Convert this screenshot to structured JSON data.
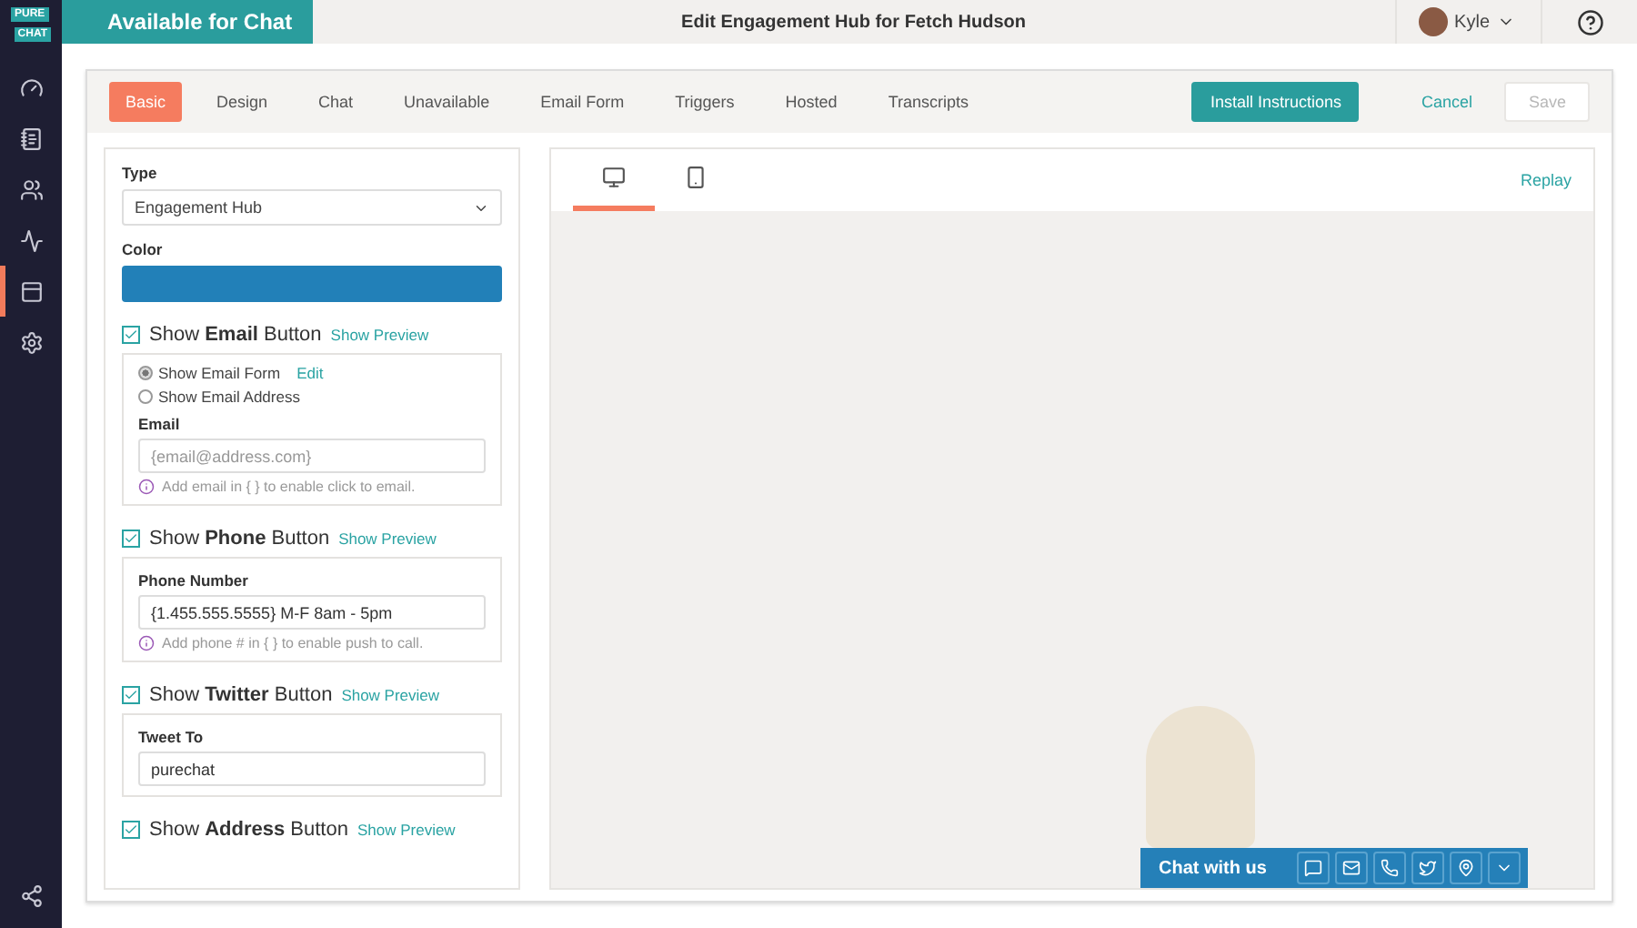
{
  "logo": {
    "line_1": "PURE",
    "line_2": "CHAT"
  },
  "sidebar": {
    "items": [
      {
        "kind": "gauge",
        "selected": false
      },
      {
        "kind": "notes",
        "selected": false
      },
      {
        "kind": "people",
        "selected": false
      },
      {
        "kind": "analytics",
        "selected": false
      },
      {
        "kind": "widget",
        "selected": true
      },
      {
        "kind": "settings",
        "selected": false
      }
    ],
    "bottom": {
      "kind": "share"
    }
  },
  "status": "Available for Chat",
  "page_title": "Edit Engagement Hub for Fetch Hudson",
  "user": {
    "name": "Kyle"
  },
  "tabs": [
    {
      "label": "Basic",
      "selected": true
    },
    {
      "label": "Design",
      "selected": false
    },
    {
      "label": "Chat",
      "selected": false
    },
    {
      "label": "Unavailable",
      "selected": false
    },
    {
      "label": "Email Form",
      "selected": false
    },
    {
      "label": "Triggers",
      "selected": false
    },
    {
      "label": "Hosted",
      "selected": false
    },
    {
      "label": "Transcripts",
      "selected": false
    }
  ],
  "actions": {
    "install": "Install Instructions",
    "cancel": "Cancel",
    "save": {
      "label": "Save",
      "disabled": true
    }
  },
  "type_field": {
    "label": "Type",
    "value": "Engagement Hub"
  },
  "color_field": {
    "label": "Color",
    "color": "#2280b8"
  },
  "sections": [
    {
      "title": "Show **Email** Button",
      "checked": true,
      "preview": "Show Preview",
      "body": [
        {
          "kind": "radio",
          "label": "Show Email Form",
          "selected": true,
          "link": "Edit"
        },
        {
          "kind": "radio",
          "label": "Show Email Address",
          "selected": false
        },
        {
          "kind": "label",
          "text": "Email"
        },
        {
          "kind": "input",
          "placeholder": "{email@address.com}"
        },
        {
          "kind": "hint",
          "text": "Add email in { } to enable click to email."
        }
      ]
    },
    {
      "title": "Show **Phone** Button",
      "checked": true,
      "preview": "Show Preview",
      "body": [
        {
          "kind": "label",
          "text": "Phone Number"
        },
        {
          "kind": "input",
          "value": "{1.455.555.5555} M-F 8am - 5pm"
        },
        {
          "kind": "hint",
          "text": "Add phone # in { } to enable push to call."
        }
      ]
    },
    {
      "title": "Show **Twitter** Button",
      "checked": true,
      "preview": "Show Preview",
      "body": [
        {
          "kind": "label",
          "text": "Tweet To"
        },
        {
          "kind": "input",
          "value": "purechat"
        }
      ]
    },
    {
      "title": "Show **Address** Button",
      "checked": true,
      "preview": "Show Preview"
    }
  ],
  "preview": {
    "devices": [
      {
        "kind": "desktop",
        "selected": true
      },
      {
        "kind": "mobile",
        "selected": false
      }
    ],
    "replay": "Replay",
    "chat_bar": {
      "label": "Chat with us",
      "buttons": [
        {
          "kind": "chat"
        },
        {
          "kind": "email"
        },
        {
          "kind": "phone"
        },
        {
          "kind": "twitter"
        },
        {
          "kind": "location"
        },
        {
          "kind": "collapse"
        }
      ]
    }
  }
}
